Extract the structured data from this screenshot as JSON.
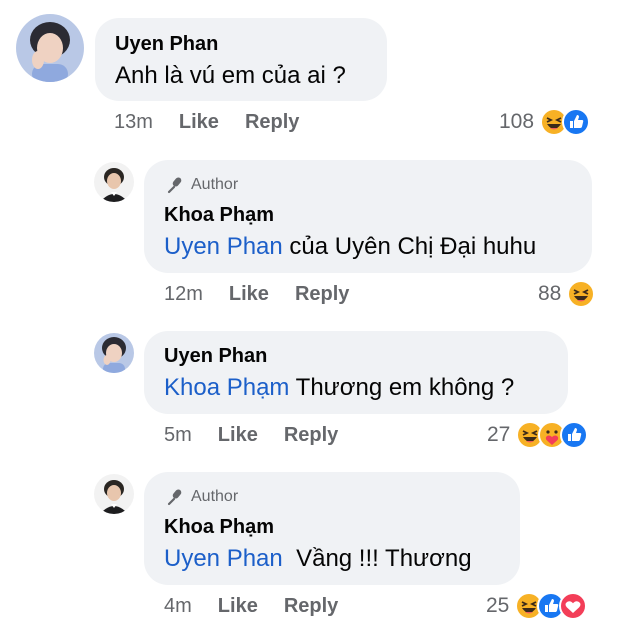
{
  "colors": {
    "mention": "#1c5fc9",
    "bubble": "#f0f2f5",
    "meta": "#65676b",
    "like_blue": "#1877f2",
    "love_red": "#f33e58"
  },
  "comments": [
    {
      "name": "Uyen Phan",
      "mention": "",
      "text": "Anh là vú em của ai ?",
      "time": "13m",
      "like": "Like",
      "reply": "Reply",
      "reaction_count": "108",
      "reactions": [
        "haha-icon",
        "like-icon"
      ]
    },
    {
      "author_badge": "Author",
      "name": "Khoa Phạm",
      "mention": "Uyen Phan",
      "text": " của Uyên Chị Đại huhu",
      "time": "12m",
      "like": "Like",
      "reply": "Reply",
      "reaction_count": "88",
      "reactions": [
        "haha-icon"
      ]
    },
    {
      "name": "Uyen Phan",
      "mention": "Khoa Phạm",
      "text": " Thương em không ?",
      "time": "5m",
      "like": "Like",
      "reply": "Reply",
      "reaction_count": "27",
      "reactions": [
        "haha-icon",
        "care-icon",
        "like-icon"
      ]
    },
    {
      "author_badge": "Author",
      "name": "Khoa Phạm",
      "mention": "Uyen Phan",
      "text": "  Vầng !!! Thương",
      "time": "4m",
      "like": "Like",
      "reply": "Reply",
      "reaction_count": "25",
      "reactions": [
        "haha-icon",
        "like-icon",
        "love-icon"
      ]
    }
  ]
}
